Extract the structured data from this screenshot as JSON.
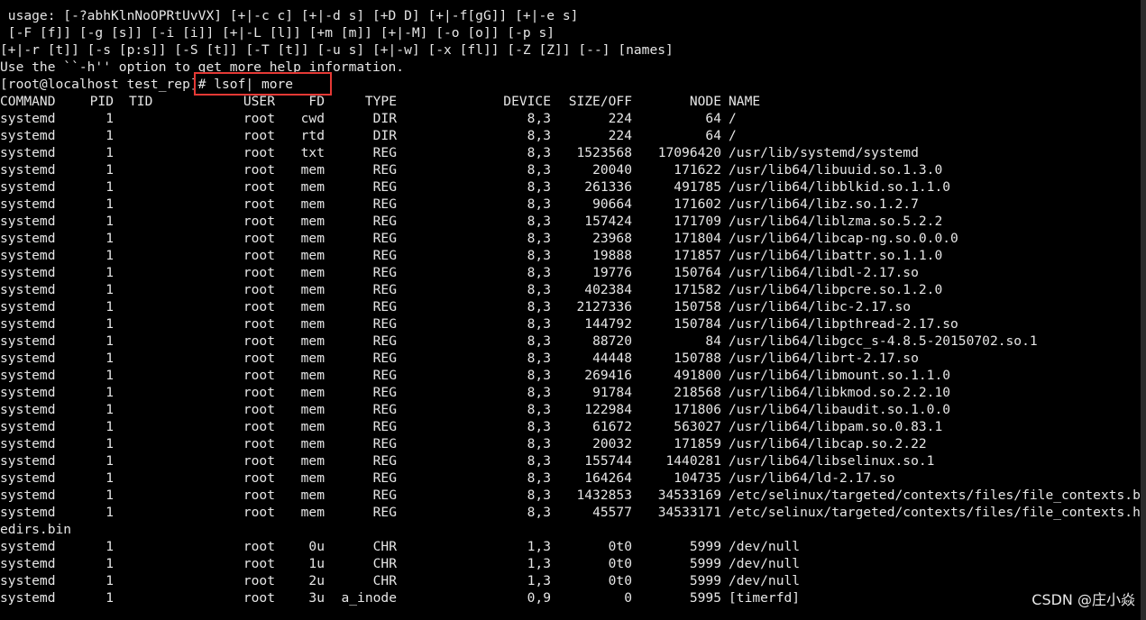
{
  "theme": {
    "background": "#000000",
    "foreground": "#e6e6e6",
    "highlight_border": "#e53935"
  },
  "usage_lines": [
    " usage: [-?abhKlnNoOPRtUvVX] [+|-c c] [+|-d s] [+D D] [+|-f[gG]] [+|-e s]",
    " [-F [f]] [-g [s]] [-i [i]] [+|-L [l]] [+m [m]] [+|-M] [-o [o]] [-p s]",
    "[+|-r [t]] [-s [p:s]] [-S [t]] [-T [t]] [-u s] [+|-w] [-x [fl]] [-Z [Z]] [--] [names]",
    "Use the ``-h'' option to get more help information."
  ],
  "prompt": {
    "text": "[root@localhost test_rep]",
    "command": "# lsof| more"
  },
  "table": {
    "headers": {
      "command": "COMMAND",
      "pid": "PID",
      "tid": "TID",
      "user": "USER",
      "fd": "FD",
      "type": "TYPE",
      "device": "DEVICE",
      "size": "SIZE/OFF",
      "node": "NODE",
      "name": "NAME"
    },
    "rows": [
      {
        "command": "systemd",
        "pid": "1",
        "user": "root",
        "fd": "cwd",
        "type": "DIR",
        "device": "8,3",
        "size": "224",
        "node": "64",
        "name": "/"
      },
      {
        "command": "systemd",
        "pid": "1",
        "user": "root",
        "fd": "rtd",
        "type": "DIR",
        "device": "8,3",
        "size": "224",
        "node": "64",
        "name": "/"
      },
      {
        "command": "systemd",
        "pid": "1",
        "user": "root",
        "fd": "txt",
        "type": "REG",
        "device": "8,3",
        "size": "1523568",
        "node": "17096420",
        "name": "/usr/lib/systemd/systemd"
      },
      {
        "command": "systemd",
        "pid": "1",
        "user": "root",
        "fd": "mem",
        "type": "REG",
        "device": "8,3",
        "size": "20040",
        "node": "171622",
        "name": "/usr/lib64/libuuid.so.1.3.0"
      },
      {
        "command": "systemd",
        "pid": "1",
        "user": "root",
        "fd": "mem",
        "type": "REG",
        "device": "8,3",
        "size": "261336",
        "node": "491785",
        "name": "/usr/lib64/libblkid.so.1.1.0"
      },
      {
        "command": "systemd",
        "pid": "1",
        "user": "root",
        "fd": "mem",
        "type": "REG",
        "device": "8,3",
        "size": "90664",
        "node": "171602",
        "name": "/usr/lib64/libz.so.1.2.7"
      },
      {
        "command": "systemd",
        "pid": "1",
        "user": "root",
        "fd": "mem",
        "type": "REG",
        "device": "8,3",
        "size": "157424",
        "node": "171709",
        "name": "/usr/lib64/liblzma.so.5.2.2"
      },
      {
        "command": "systemd",
        "pid": "1",
        "user": "root",
        "fd": "mem",
        "type": "REG",
        "device": "8,3",
        "size": "23968",
        "node": "171804",
        "name": "/usr/lib64/libcap-ng.so.0.0.0"
      },
      {
        "command": "systemd",
        "pid": "1",
        "user": "root",
        "fd": "mem",
        "type": "REG",
        "device": "8,3",
        "size": "19888",
        "node": "171857",
        "name": "/usr/lib64/libattr.so.1.1.0"
      },
      {
        "command": "systemd",
        "pid": "1",
        "user": "root",
        "fd": "mem",
        "type": "REG",
        "device": "8,3",
        "size": "19776",
        "node": "150764",
        "name": "/usr/lib64/libdl-2.17.so"
      },
      {
        "command": "systemd",
        "pid": "1",
        "user": "root",
        "fd": "mem",
        "type": "REG",
        "device": "8,3",
        "size": "402384",
        "node": "171582",
        "name": "/usr/lib64/libpcre.so.1.2.0"
      },
      {
        "command": "systemd",
        "pid": "1",
        "user": "root",
        "fd": "mem",
        "type": "REG",
        "device": "8,3",
        "size": "2127336",
        "node": "150758",
        "name": "/usr/lib64/libc-2.17.so"
      },
      {
        "command": "systemd",
        "pid": "1",
        "user": "root",
        "fd": "mem",
        "type": "REG",
        "device": "8,3",
        "size": "144792",
        "node": "150784",
        "name": "/usr/lib64/libpthread-2.17.so"
      },
      {
        "command": "systemd",
        "pid": "1",
        "user": "root",
        "fd": "mem",
        "type": "REG",
        "device": "8,3",
        "size": "88720",
        "node": "84",
        "name": "/usr/lib64/libgcc_s-4.8.5-20150702.so.1"
      },
      {
        "command": "systemd",
        "pid": "1",
        "user": "root",
        "fd": "mem",
        "type": "REG",
        "device": "8,3",
        "size": "44448",
        "node": "150788",
        "name": "/usr/lib64/librt-2.17.so"
      },
      {
        "command": "systemd",
        "pid": "1",
        "user": "root",
        "fd": "mem",
        "type": "REG",
        "device": "8,3",
        "size": "269416",
        "node": "491800",
        "name": "/usr/lib64/libmount.so.1.1.0"
      },
      {
        "command": "systemd",
        "pid": "1",
        "user": "root",
        "fd": "mem",
        "type": "REG",
        "device": "8,3",
        "size": "91784",
        "node": "218568",
        "name": "/usr/lib64/libkmod.so.2.2.10"
      },
      {
        "command": "systemd",
        "pid": "1",
        "user": "root",
        "fd": "mem",
        "type": "REG",
        "device": "8,3",
        "size": "122984",
        "node": "171806",
        "name": "/usr/lib64/libaudit.so.1.0.0"
      },
      {
        "command": "systemd",
        "pid": "1",
        "user": "root",
        "fd": "mem",
        "type": "REG",
        "device": "8,3",
        "size": "61672",
        "node": "563027",
        "name": "/usr/lib64/libpam.so.0.83.1"
      },
      {
        "command": "systemd",
        "pid": "1",
        "user": "root",
        "fd": "mem",
        "type": "REG",
        "device": "8,3",
        "size": "20032",
        "node": "171859",
        "name": "/usr/lib64/libcap.so.2.22"
      },
      {
        "command": "systemd",
        "pid": "1",
        "user": "root",
        "fd": "mem",
        "type": "REG",
        "device": "8,3",
        "size": "155744",
        "node": "1440281",
        "name": "/usr/lib64/libselinux.so.1"
      },
      {
        "command": "systemd",
        "pid": "1",
        "user": "root",
        "fd": "mem",
        "type": "REG",
        "device": "8,3",
        "size": "164264",
        "node": "104735",
        "name": "/usr/lib64/ld-2.17.so"
      },
      {
        "command": "systemd",
        "pid": "1",
        "user": "root",
        "fd": "mem",
        "type": "REG",
        "device": "8,3",
        "size": "1432853",
        "node": "34533169",
        "name": "/etc/selinux/targeted/contexts/files/file_contexts.b"
      },
      {
        "command": "systemd",
        "pid": "1",
        "user": "root",
        "fd": "mem",
        "type": "REG",
        "device": "8,3",
        "size": "45577",
        "node": "34533171",
        "name": "/etc/selinux/targeted/contexts/files/file_contexts.h"
      }
    ],
    "wrap_line": "edirs.bin",
    "rows_after": [
      {
        "command": "systemd",
        "pid": "1",
        "user": "root",
        "fd": "0u",
        "type": "CHR",
        "device": "1,3",
        "size": "0t0",
        "node": "5999",
        "name": "/dev/null"
      },
      {
        "command": "systemd",
        "pid": "1",
        "user": "root",
        "fd": "1u",
        "type": "CHR",
        "device": "1,3",
        "size": "0t0",
        "node": "5999",
        "name": "/dev/null"
      },
      {
        "command": "systemd",
        "pid": "1",
        "user": "root",
        "fd": "2u",
        "type": "CHR",
        "device": "1,3",
        "size": "0t0",
        "node": "5999",
        "name": "/dev/null"
      },
      {
        "command": "systemd",
        "pid": "1",
        "user": "root",
        "fd": "3u",
        "type": "a_inode",
        "device": "0,9",
        "size": "0",
        "node": "5995",
        "name": "[timerfd]"
      }
    ]
  },
  "watermark": "CSDN @庄小焱"
}
